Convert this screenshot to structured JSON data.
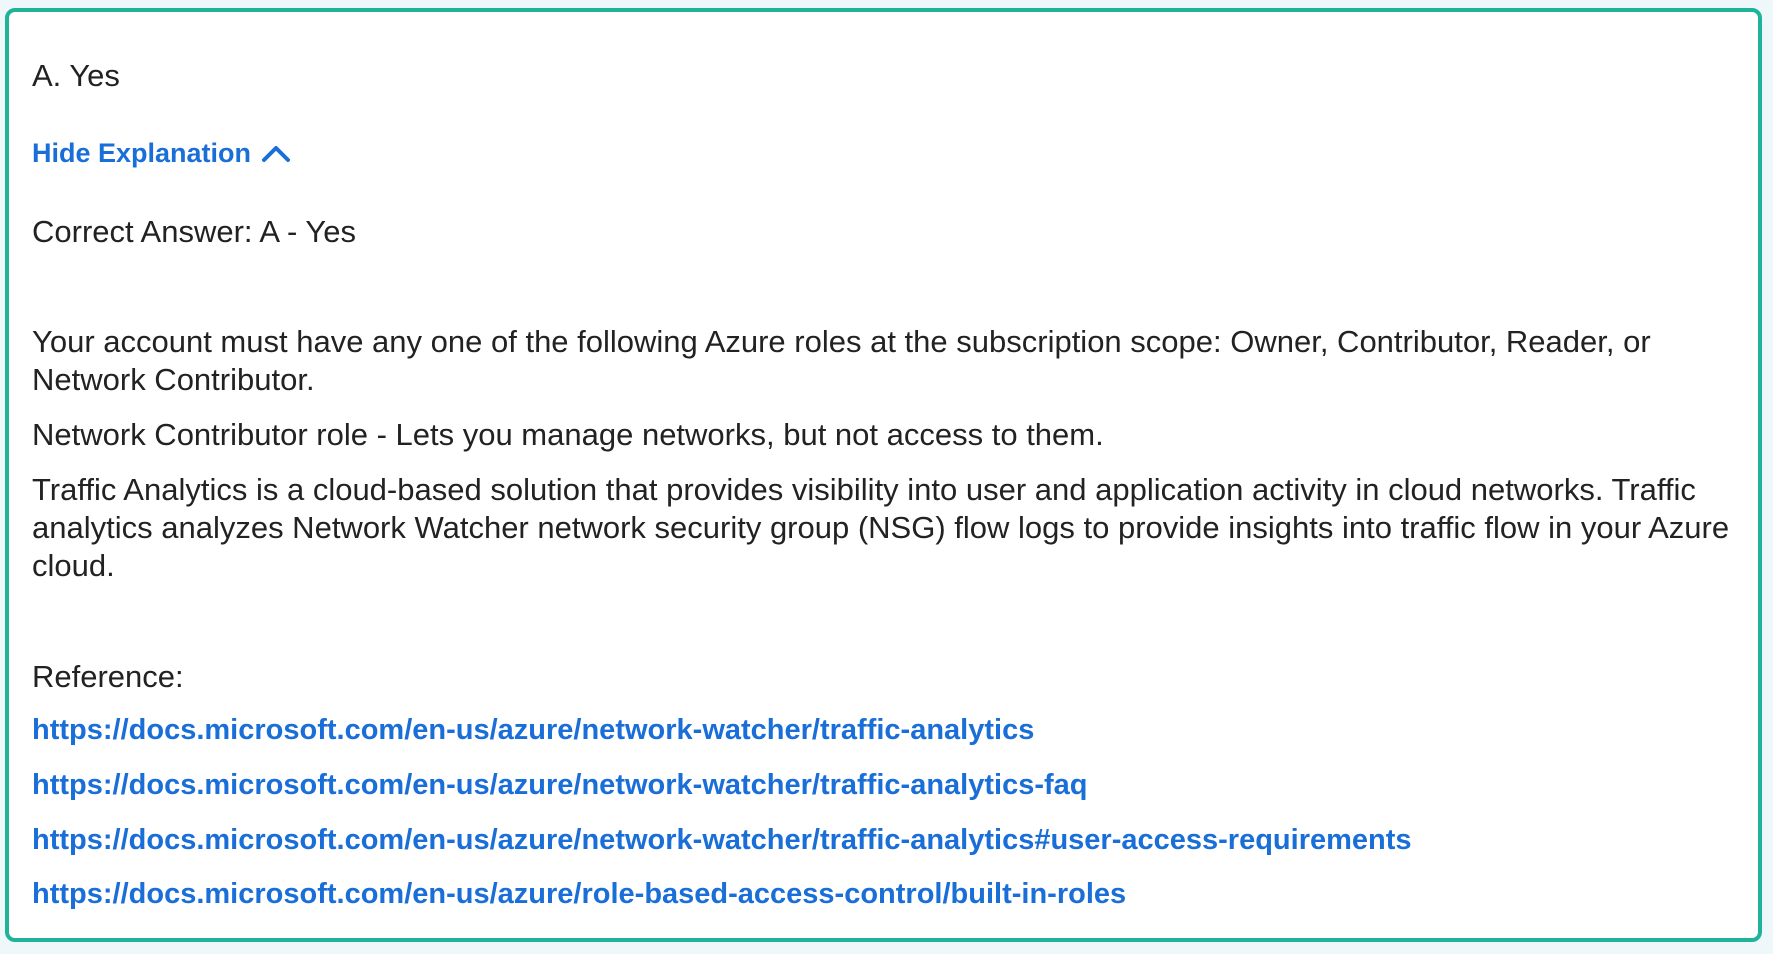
{
  "option": {
    "label": "A. Yes"
  },
  "toggle": {
    "label": "Hide Explanation",
    "icon": "chevron-up-icon"
  },
  "answer": {
    "text": "Correct Answer: A - Yes"
  },
  "paragraphs": [
    "Your account must have any one of the following Azure roles at the subscription scope: Owner, Contributor, Reader, or Network Contributor.",
    "Network Contributor role - Lets you manage networks, but not access to them.",
    "Traffic Analytics is a cloud-based solution that provides visibility into user and application activity in cloud networks. Traffic analytics analyzes Network Watcher network security group (NSG) flow logs to provide insights into traffic flow in your Azure cloud."
  ],
  "reference": {
    "label": "Reference:",
    "links": [
      "https://docs.microsoft.com/en-us/azure/network-watcher/traffic-analytics",
      "https://docs.microsoft.com/en-us/azure/network-watcher/traffic-analytics-faq",
      "https://docs.microsoft.com/en-us/azure/network-watcher/traffic-analytics#user-access-requirements",
      "https://docs.microsoft.com/en-us/azure/role-based-access-control/built-in-roles"
    ]
  },
  "colors": {
    "border": "#1fb39a",
    "link": "#1a6ed8",
    "text": "#222222"
  }
}
